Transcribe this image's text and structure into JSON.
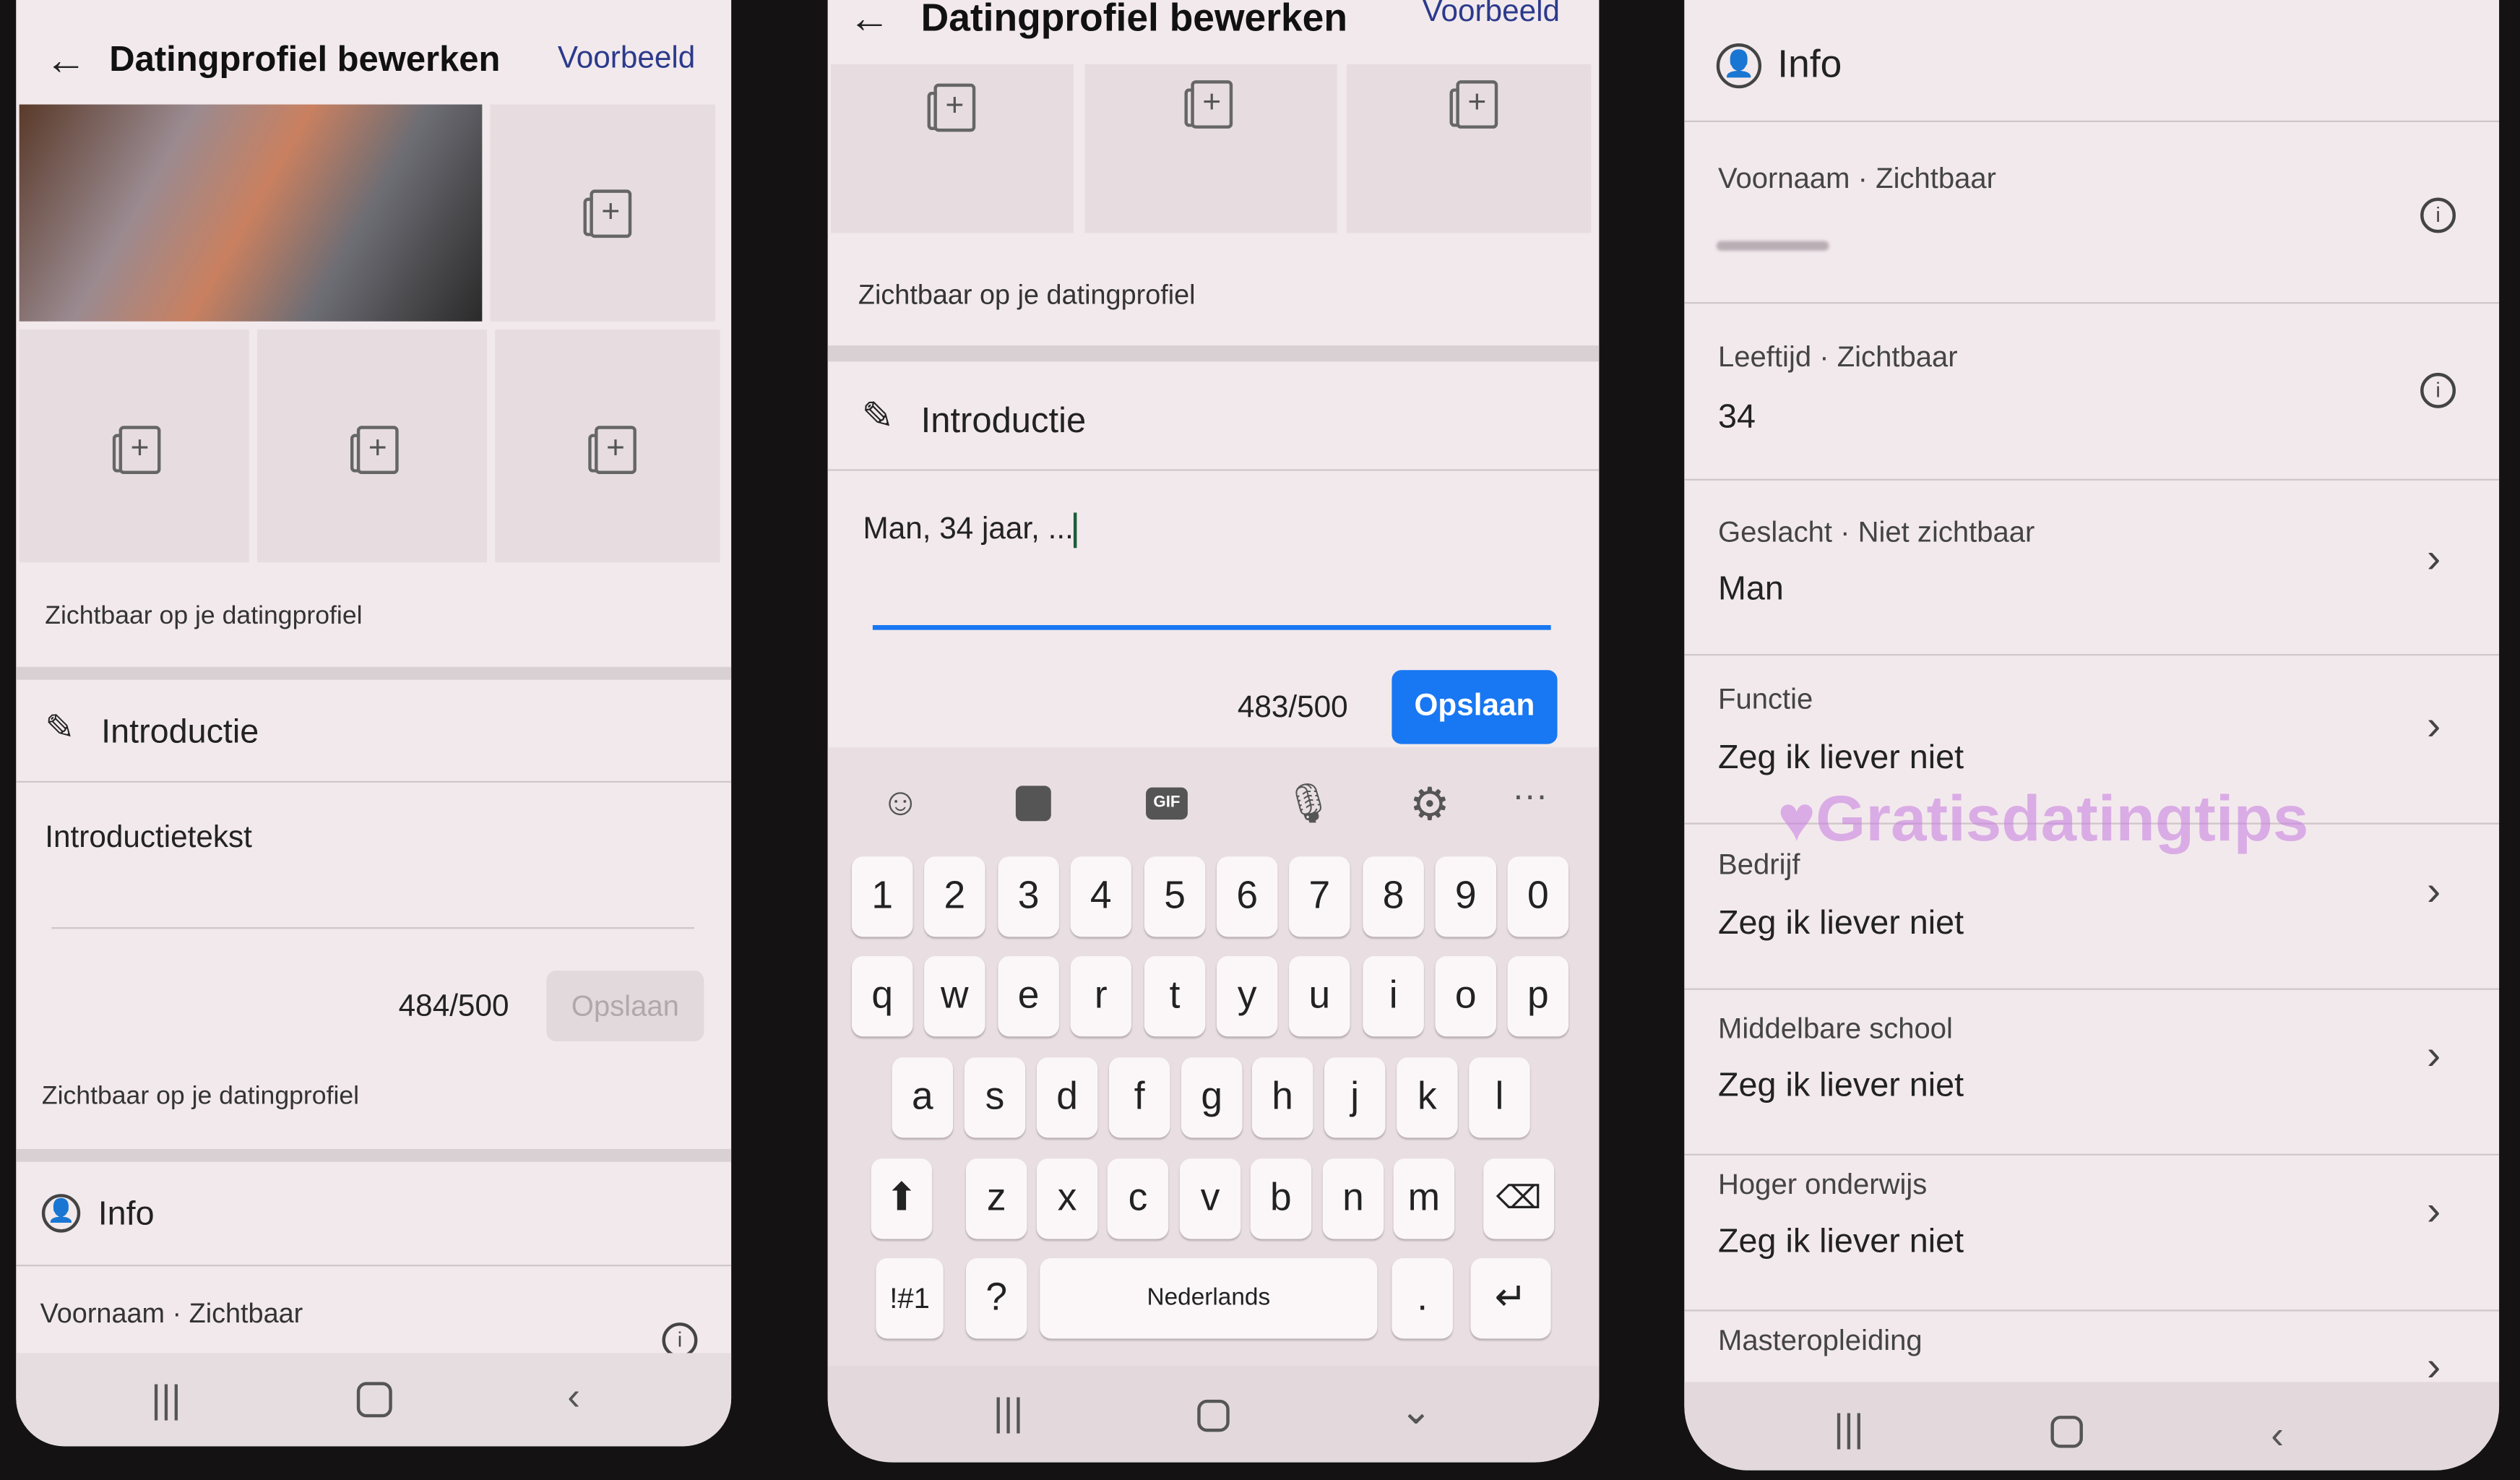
{
  "left": {
    "header": {
      "title": "Datingprofiel bewerken",
      "preview": "Voorbeeld"
    },
    "visible_note_1": "Zichtbaar op je datingprofiel",
    "intro": {
      "heading": "Introductie",
      "placeholder": "Introductietekst",
      "counter": "484/500",
      "save": "Opslaan"
    },
    "visible_note_2": "Zichtbaar op je datingprofiel",
    "info": {
      "heading": "Info",
      "first_label": "Voornaam · Zichtbaar"
    }
  },
  "middle": {
    "header": {
      "title": "Datingprofiel bewerken",
      "preview": "Voorbeeld"
    },
    "visible_note": "Zichtbaar op je datingprofiel",
    "intro": {
      "heading": "Introductie",
      "value": "Man, 34 jaar, ...",
      "counter": "483/500",
      "save": "Opslaan"
    },
    "keyboard": {
      "toolbar": [
        "emoji-icon",
        "sticker-icon",
        "GIF",
        "mic-icon",
        "gear-icon",
        "more-icon"
      ],
      "numbers": [
        "1",
        "2",
        "3",
        "4",
        "5",
        "6",
        "7",
        "8",
        "9",
        "0"
      ],
      "row1": [
        "q",
        "w",
        "e",
        "r",
        "t",
        "y",
        "u",
        "i",
        "o",
        "p"
      ],
      "row2": [
        "a",
        "s",
        "d",
        "f",
        "g",
        "h",
        "j",
        "k",
        "l"
      ],
      "row3": [
        "z",
        "x",
        "c",
        "v",
        "b",
        "n",
        "m"
      ],
      "symbols": "!#1",
      "question": "?",
      "space": "Nederlands",
      "period": "."
    }
  },
  "right": {
    "heading": "Info",
    "rows": [
      {
        "label": "Voornaam · Zichtbaar",
        "value": "",
        "icon": "info-icon"
      },
      {
        "label": "Leeftijd · Zichtbaar",
        "value": "34",
        "icon": "info-icon"
      },
      {
        "label": "Geslacht · Niet zichtbaar",
        "value": "Man",
        "icon": "chevron-right-icon"
      },
      {
        "label": "Functie",
        "value": "Zeg ik liever niet",
        "icon": "chevron-right-icon"
      },
      {
        "label": "Bedrijf",
        "value": "Zeg ik liever niet",
        "icon": "chevron-right-icon"
      },
      {
        "label": "Middelbare school",
        "value": "Zeg ik liever niet",
        "icon": "chevron-right-icon"
      },
      {
        "label": "Hoger onderwijs",
        "value": "Zeg ik liever niet",
        "icon": "chevron-right-icon"
      },
      {
        "label": "Masteropleiding",
        "value": "",
        "icon": "chevron-right-icon"
      }
    ],
    "watermark": "Gratisdatingtips"
  },
  "colors": {
    "accent": "#1877f2",
    "link": "#2b3a8c",
    "watermark": "#c77be0"
  }
}
